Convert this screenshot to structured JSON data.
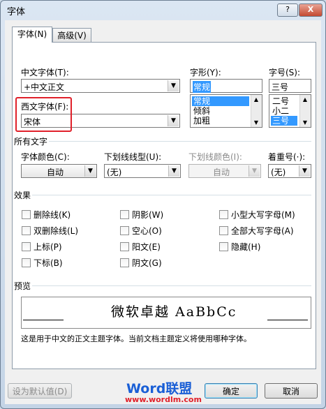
{
  "window": {
    "title": "字体",
    "help_label": "?",
    "close_label": "X"
  },
  "tabs": [
    {
      "label": "字体(N)"
    },
    {
      "label": "高级(V)"
    }
  ],
  "fields": {
    "chinese_font": {
      "label": "中文字体(T):",
      "value": "+中文正文"
    },
    "western_font": {
      "label": "西文字体(F):",
      "value": "宋体"
    },
    "style": {
      "label": "字形(Y):",
      "value": "常规",
      "options": [
        "常规",
        "倾斜",
        "加粗"
      ]
    },
    "size": {
      "label": "字号(S):",
      "value": "三号",
      "options": [
        "二号",
        "小二",
        "三号"
      ]
    }
  },
  "all_text": {
    "heading": "所有文字",
    "font_color": {
      "label": "字体颜色(C):",
      "value": "自动"
    },
    "underline_style": {
      "label": "下划线线型(U):",
      "value": "(无)"
    },
    "underline_color": {
      "label": "下划线颜色(I):",
      "value": "自动"
    },
    "emphasis": {
      "label": "着重号(·):",
      "value": "(无)"
    }
  },
  "effects": {
    "heading": "效果",
    "col1": [
      "删除线(K)",
      "双删除线(L)",
      "上标(P)",
      "下标(B)"
    ],
    "col2": [
      "阴影(W)",
      "空心(O)",
      "阳文(E)",
      "阴文(G)"
    ],
    "col3": [
      "小型大写字母(M)",
      "全部大写字母(A)",
      "隐藏(H)"
    ]
  },
  "preview": {
    "heading": "预览",
    "sample": "微软卓越  AaBbCc",
    "note": "这是用于中文的正文主题字体。当前文档主题定义将使用哪种字体。"
  },
  "buttons": {
    "set_default": "设为默认值(D)",
    "ok": "确定",
    "cancel": "取消"
  },
  "watermark": {
    "brand": "Word联盟",
    "url": "www.wordlm.com"
  },
  "colors": {
    "highlight": "#3399ff",
    "annotation_box": "#e0202a"
  }
}
